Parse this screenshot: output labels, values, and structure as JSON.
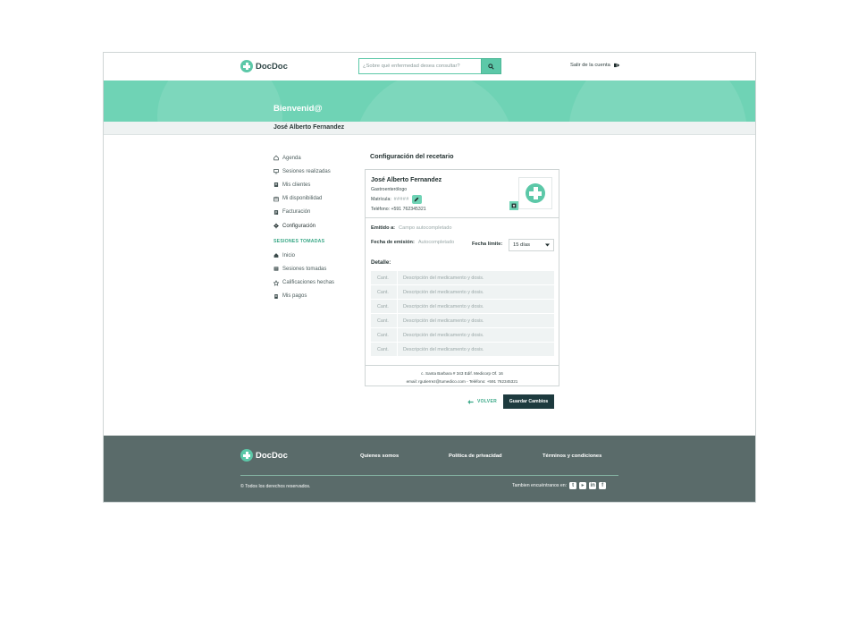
{
  "app": {
    "name": "DocDoc"
  },
  "header": {
    "search_placeholder": "¿Sobre qué enfermedad desea consultar?",
    "logout_label": "Salir de la cuenta"
  },
  "banner": {
    "title": "Bienvenid@",
    "user_name": "José Alberto Fernandez"
  },
  "sidebar": {
    "items": [
      {
        "label": "Agenda",
        "icon": "home-icon"
      },
      {
        "label": "Sesiones realizadas",
        "icon": "monitor-icon"
      },
      {
        "label": "Mis clientes",
        "icon": "contacts-icon"
      },
      {
        "label": "Mi disponibilidad",
        "icon": "calendar-icon"
      },
      {
        "label": "Facturación",
        "icon": "invoice-icon"
      },
      {
        "label": "Configuración",
        "icon": "gear-icon"
      }
    ],
    "section_title": "SESIONES TOMADAS",
    "section_items": [
      {
        "label": "Inicio",
        "icon": "home-icon"
      },
      {
        "label": "Sesiones tomadas",
        "icon": "list-icon"
      },
      {
        "label": "Calificaciones hechas",
        "icon": "star-icon"
      },
      {
        "label": "Mis pagos",
        "icon": "receipt-icon"
      }
    ]
  },
  "main": {
    "title": "Configuración del recetario",
    "doctor": {
      "name": "José Alberto Fernandez",
      "specialty": "Gastroenterólogo",
      "matricula_label": "Matrícula:",
      "matricula_value": "#####",
      "telefono": "Teléfono: +591 762345321"
    },
    "emitido_label": "Emitido a:",
    "emitido_placeholder": "Campo autocompletado",
    "fecha_emision_label": "Fecha de emisión:",
    "fecha_emision_placeholder": "Autocompletado",
    "fecha_limite_label": "Fecha límite:",
    "fecha_limite_value": "15 días",
    "detalle_label": "Detalle:",
    "items": [
      {
        "cant": "Cant.",
        "desc": "Descripción del medicamento y dosis."
      },
      {
        "cant": "Cant.",
        "desc": "Descripción del medicamento y dosis."
      },
      {
        "cant": "Cant.",
        "desc": "Descripción del medicamento y dosis."
      },
      {
        "cant": "Cant.",
        "desc": "Descripción del medicamento y dosis."
      },
      {
        "cant": "Cant.",
        "desc": "Descripción del medicamento y dosis."
      },
      {
        "cant": "Cant.",
        "desc": "Descripción del medicamento y dosis."
      }
    ],
    "footer_address": "c. Santa Barbara # 343 Edif. Medicorp Of. 16",
    "footer_contact": "email: rgutierrez@tumedico.com - Teléfono: +591 762345321",
    "back_label": "VOLVER",
    "save_label": "Guardar Cambios"
  },
  "footer": {
    "links": [
      "Quienes somos",
      "Política de privacidad",
      "Términos y condiciones"
    ],
    "copyright": "© Todos los derechos reservados.",
    "social_label": "Tambien encuéntranos en:",
    "social_icons": [
      "twitter-icon",
      "youtube-icon",
      "linkedin-icon",
      "facebook-icon"
    ]
  },
  "colors": {
    "accent": "#6fd3b5",
    "dark_button": "#1d3a3e",
    "footer_bg": "#5a6b6a"
  }
}
